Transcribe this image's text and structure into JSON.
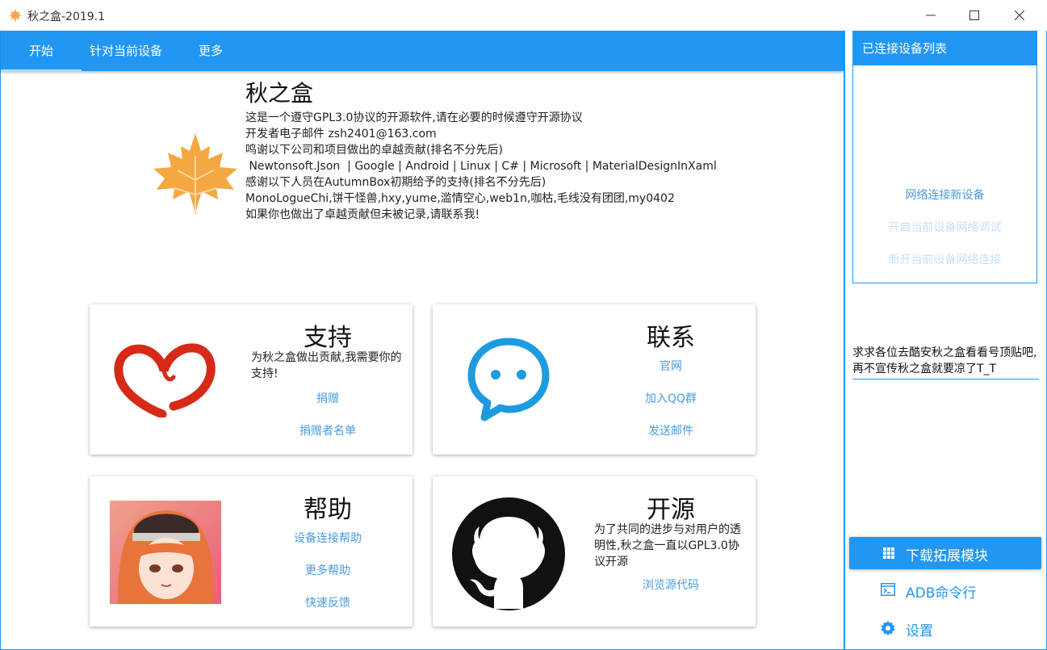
{
  "window": {
    "title": "秋之盒-2019.1",
    "minimize_glyph": "—",
    "maximize_glyph": "☐",
    "close_glyph": "✕"
  },
  "tabs": [
    {
      "label": "开始",
      "active": true
    },
    {
      "label": "针对当前设备",
      "active": false
    },
    {
      "label": "更多",
      "active": false
    }
  ],
  "about": {
    "app_name": "秋之盒",
    "lines": [
      "这是一个遵守GPL3.0协议的开源软件,请在必要的时候遵守开源协议",
      "开发者电子邮件 zsh2401@163.com",
      "",
      "鸣谢以下公司和项目做出的卓越贡献(排名不分先后)",
      " Newtonsoft.Json  | Google | Android | Linux | C# | Microsoft | MaterialDesignInXaml",
      "",
      "感谢以下人员在AutumnBox初期给予的支持(排名不分先后)",
      "MonoLogueChi,饼干怪兽,hxy,yume,滥情空心,web1n,咖枯,毛线没有团团,my0402",
      "",
      "如果你也做出了卓越贡献但未被记录,请联系我!"
    ]
  },
  "cards": {
    "support": {
      "title": "支持",
      "desc": "为秋之盒做出贡献,我需要你的支持!",
      "links": [
        "捐赠",
        "捐赠者名单"
      ]
    },
    "contact": {
      "title": "联系",
      "links": [
        "官网",
        "加入QQ群",
        "发送邮件"
      ]
    },
    "help": {
      "title": "帮助",
      "links": [
        "设备连接帮助",
        "更多帮助",
        "快速反馈"
      ]
    },
    "opensource": {
      "title": "开源",
      "desc": "为了共同的进步与对用户的透明性,秋之盒一直以GPL3.0协议开源",
      "links": [
        "浏览源代码"
      ]
    }
  },
  "device_panel": {
    "header": "已连接设备列表",
    "actions": [
      "网络连接新设备",
      "开启当前设备网络调试",
      "断开当前设备网络连接"
    ]
  },
  "notice": "求求各位去酷安秋之盒看看号顶贴吧,再不宣传秋之盒就要凉了T_T",
  "sidebar_menu": {
    "download_label": "下载拓展模块",
    "adb_label": "ADB命令行",
    "settings_label": "设置"
  },
  "colors": {
    "accent": "#2196f3",
    "link": "#4a9be0",
    "disabled_link": "#c7dff5",
    "leaf": "#f5a742",
    "heart": "#d62a18",
    "chat": "#1e9ae0"
  },
  "icons": {
    "app": "maple-leaf-icon",
    "support": "heart-icon",
    "contact": "chat-bubble-icon",
    "help": "anime-avatar-image",
    "opensource": "github-octocat-icon",
    "download": "grid-icon",
    "adb": "terminal-icon",
    "settings": "gear-icon"
  }
}
